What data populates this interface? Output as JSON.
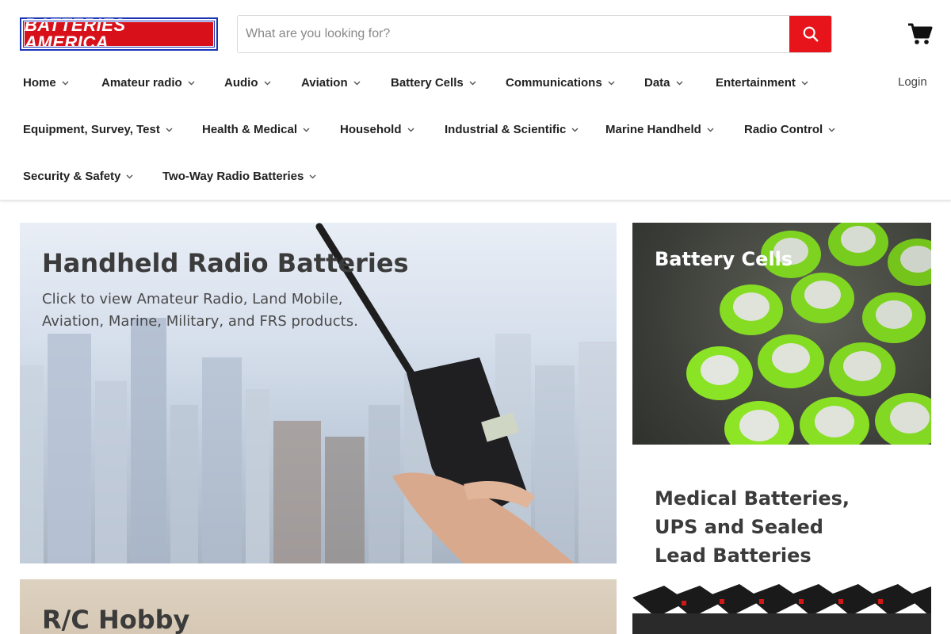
{
  "brand": {
    "logo_text": "BATTERIES AMERICA",
    "primary_color": "#e8141c",
    "logo_border_color": "#1a33b5"
  },
  "search": {
    "placeholder": "What are you looking for?",
    "value": "",
    "icon": "search-icon"
  },
  "header": {
    "cart_icon": "cart-icon",
    "login_label": "Login"
  },
  "nav": {
    "row1": [
      "Home",
      "Amateur radio",
      "Audio",
      "Aviation",
      "Battery Cells",
      "Communications",
      "Data",
      "Entertainment"
    ],
    "row2": [
      "Equipment, Survey, Test",
      "Health & Medical",
      "Household",
      "Industrial & Scientific",
      "Marine Handheld",
      "Radio Control"
    ],
    "row3": [
      "Security & Safety",
      "Two-Way Radio Batteries"
    ]
  },
  "tiles": {
    "radio": {
      "title": "Handheld Radio Batteries",
      "desc_line1": "Click to view Amateur Radio, Land Mobile,",
      "desc_line2": "Aviation, Marine, Military, and FRS products."
    },
    "cells": {
      "title": "Battery Cells"
    },
    "medical": {
      "title_line1": "Medical Batteries,",
      "title_line2": "UPS and Sealed",
      "title_line3": "Lead Batteries"
    },
    "rc": {
      "title": "R/C Hobby"
    }
  }
}
